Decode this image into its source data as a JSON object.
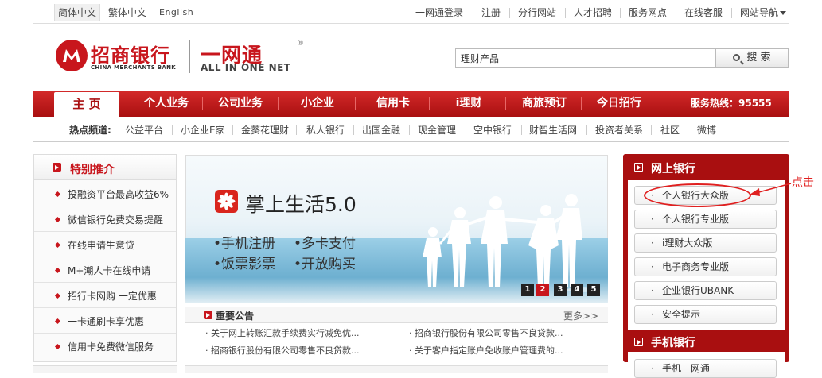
{
  "languages": [
    "简体中文",
    "繁体中文",
    "English"
  ],
  "toplinks": [
    "一网通登录",
    "注册",
    "分行网站",
    "人才招聘",
    "服务网点",
    "在线客服",
    "网站导航"
  ],
  "logo": {
    "cn": "招商银行",
    "en": "CHINA MERCHANTS BANK",
    "aio_cn": "一网通",
    "aio_en": "ALL IN ONE NET",
    "reg": "®"
  },
  "search": {
    "value": "理财产品",
    "button": "搜 索"
  },
  "nav": {
    "home": "主 页",
    "items": [
      "个人业务",
      "公司业务",
      "小企业",
      "信用卡",
      "i理财",
      "商旅预订",
      "今日招行"
    ],
    "hotline": "服务热线：95555"
  },
  "hot": {
    "label": "热点频道:",
    "items": [
      "公益平台",
      "小企业E家",
      "金葵花理财",
      "私人银行",
      "出国金融",
      "现金管理",
      "空中银行",
      "财智生活网",
      "投资者关系",
      "社区",
      "微博"
    ]
  },
  "special": {
    "title": "特别推介",
    "items": [
      "投融资平台最高收益6%",
      "微信银行免费交易提醒",
      "在线申请生意贷",
      "M+潮人卡在线申请",
      "招行卡网购 一定优惠",
      "一卡通刷卡享优惠",
      "信用卡免费微信服务"
    ]
  },
  "banner": {
    "title": "掌上生活5.0",
    "features": [
      "•手机注册",
      "•多卡支付",
      "•饭票影票",
      "•开放购买"
    ],
    "pages": [
      "1",
      "2",
      "3",
      "4",
      "5"
    ],
    "active_page": "2"
  },
  "announcements": {
    "title": "重要公告",
    "more": "更多>>",
    "items": [
      "· 关于网上转账汇款手续费实行减免优...",
      "· 招商银行股份有限公司零售不良贷款...",
      "· 招商银行股份有限公司零售不良贷款...",
      "· 关于客户指定账户免收账户管理费的..."
    ]
  },
  "online_bank": {
    "title": "网上银行",
    "buttons": [
      "个人银行大众版",
      "个人银行专业版",
      "i理财大众版",
      "电子商务专业版",
      "企业银行UBANK",
      "安全提示"
    ]
  },
  "mobile_bank": {
    "title": "手机银行",
    "buttons": [
      "手机一网通"
    ]
  },
  "annotation": {
    "text": "点击"
  },
  "colors": {
    "brand_red": "#c8161d",
    "nav_red": "#a90f10",
    "annotation_red": "#e02020"
  }
}
